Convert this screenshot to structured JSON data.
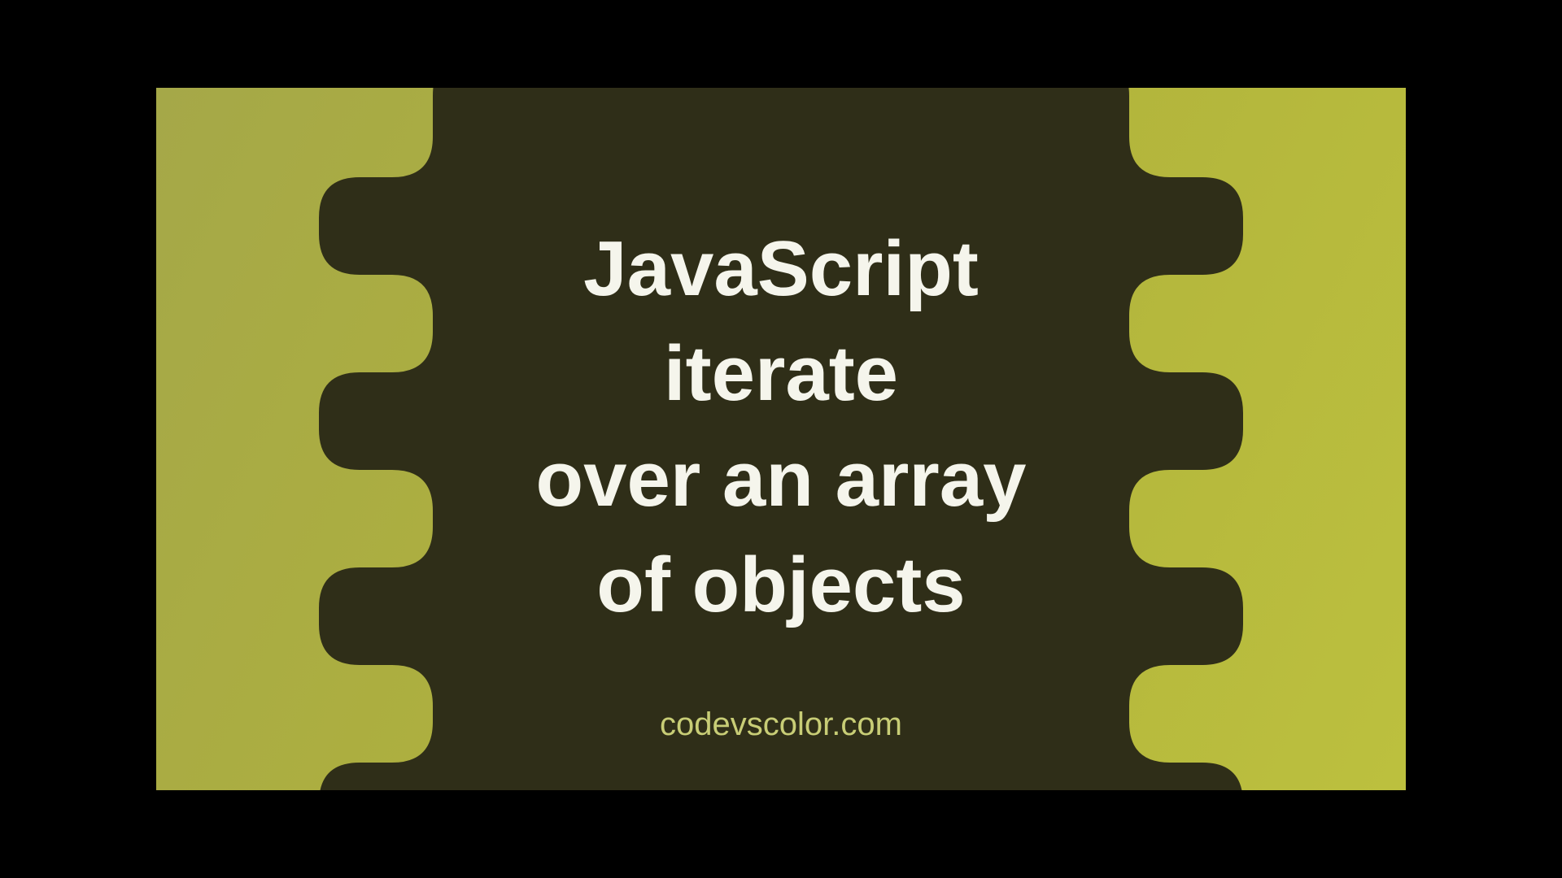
{
  "title": {
    "line1": "JavaScript",
    "line2": "iterate",
    "line3": "over an array",
    "line4": "of objects"
  },
  "attribution": "codevscolor.com",
  "colors": {
    "bg_gradient_start": "#a5a848",
    "bg_gradient_end": "#bcc03e",
    "blob": "#2f2e18",
    "title_text": "#f5f5ec",
    "attribution_text": "#c8cd76"
  }
}
